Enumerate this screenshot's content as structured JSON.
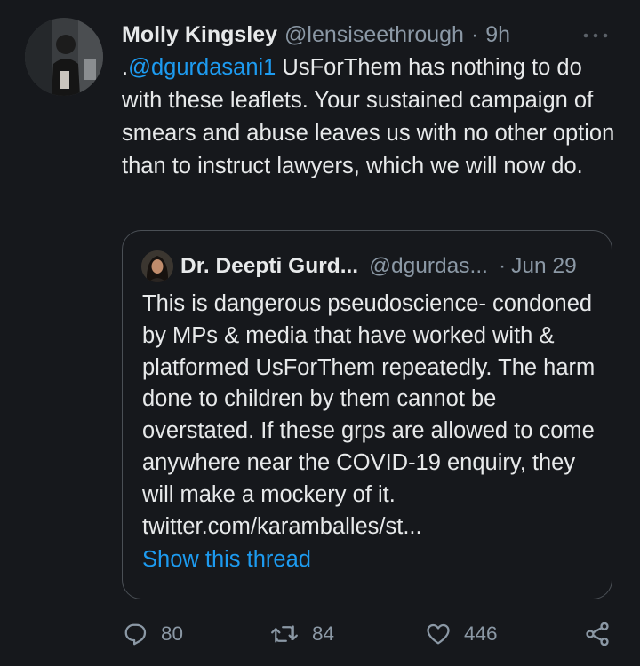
{
  "tweet": {
    "author_name": "Molly Kingsley",
    "author_handle": "@lensiseethrough",
    "separator": "·",
    "timestamp": "9h",
    "more_icon": "more-dots-icon",
    "text_prefix": ".",
    "mention": "@dgurdasani1",
    "text_body": " UsForThem has nothing to do with these leaflets. Your sustained campaign of smears and abuse leaves us with no other option than to instruct lawyers, which we will now do."
  },
  "quoted_tweet": {
    "author_name": "Dr. Deepti Gurd...",
    "author_handle": "@dgurdas...",
    "separator": "·",
    "timestamp": "Jun 29",
    "text": "This is dangerous pseudoscience- condoned by MPs & media that have worked with & platformed UsForThem repeatedly. The harm done to children by them cannot be overstated. If these grps are allowed to come anywhere near the COVID-19 enquiry, they will make a mockery of it. twitter.com/karamballes/st...",
    "show_thread_label": "Show this thread"
  },
  "actions": {
    "reply_count": "80",
    "retweet_count": "84",
    "like_count": "446",
    "reply_icon": "reply-bubble-icon",
    "retweet_icon": "retweet-icon",
    "like_icon": "heart-icon",
    "share_icon": "share-icon"
  },
  "colors": {
    "background": "#16181c",
    "text_primary": "#e7e9ea",
    "text_secondary": "#8b98a5",
    "link": "#1d9bf0",
    "border": "#4a4f55"
  }
}
